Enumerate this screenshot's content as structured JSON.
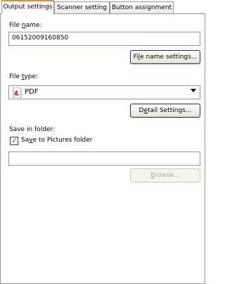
{
  "tabs": [
    {
      "label": "Output settings",
      "active": true
    },
    {
      "label": "Scanner setting",
      "active": false
    },
    {
      "label": "Button assignment",
      "active": false
    }
  ],
  "file_name": {
    "label_prefix": "File ",
    "label_mnemonic": "n",
    "label_suffix": "ame:",
    "value": "06152009160850",
    "settings_button_prefix": "Fi",
    "settings_button_mnemonic": "l",
    "settings_button_suffix": "e name settings..."
  },
  "file_type": {
    "label_prefix": "File ",
    "label_mnemonic": "t",
    "label_suffix": "ype:",
    "selected": "PDF",
    "selected_icon": "pdf-icon",
    "detail_button_prefix": "D",
    "detail_button_mnemonic": "e",
    "detail_button_suffix": "tail Settings..."
  },
  "save_folder": {
    "label": "Save in folder:",
    "checkbox_checked": true,
    "checkbox_label_prefix": "Sa",
    "checkbox_label_mnemonic": "v",
    "checkbox_label_suffix": "e to Pictures folder",
    "path_value": "",
    "browse_button_mnemonic": "B",
    "browse_button_suffix": "rowse...",
    "browse_enabled": false
  }
}
